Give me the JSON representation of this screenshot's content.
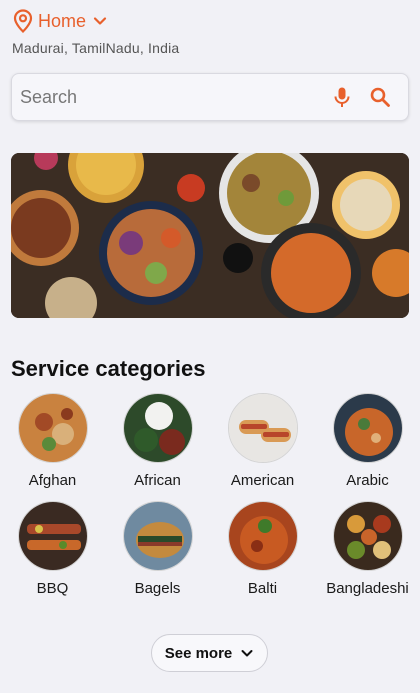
{
  "location": {
    "label": "Home",
    "address": "Madurai, TamilNadu, India",
    "icon": "location-pin-icon",
    "accent_color": "#e8602c"
  },
  "search": {
    "placeholder": "Search",
    "icons": [
      "mic-icon",
      "search-icon"
    ]
  },
  "banner": {
    "icon": "food-banner-image"
  },
  "categories": {
    "title": "Service categories",
    "items": [
      {
        "label": "Afghan"
      },
      {
        "label": "African"
      },
      {
        "label": "American"
      },
      {
        "label": "Arabic"
      },
      {
        "label": "BBQ"
      },
      {
        "label": "Bagels"
      },
      {
        "label": "Balti"
      },
      {
        "label": "Bangladeshi"
      }
    ],
    "see_more_label": "See more"
  }
}
